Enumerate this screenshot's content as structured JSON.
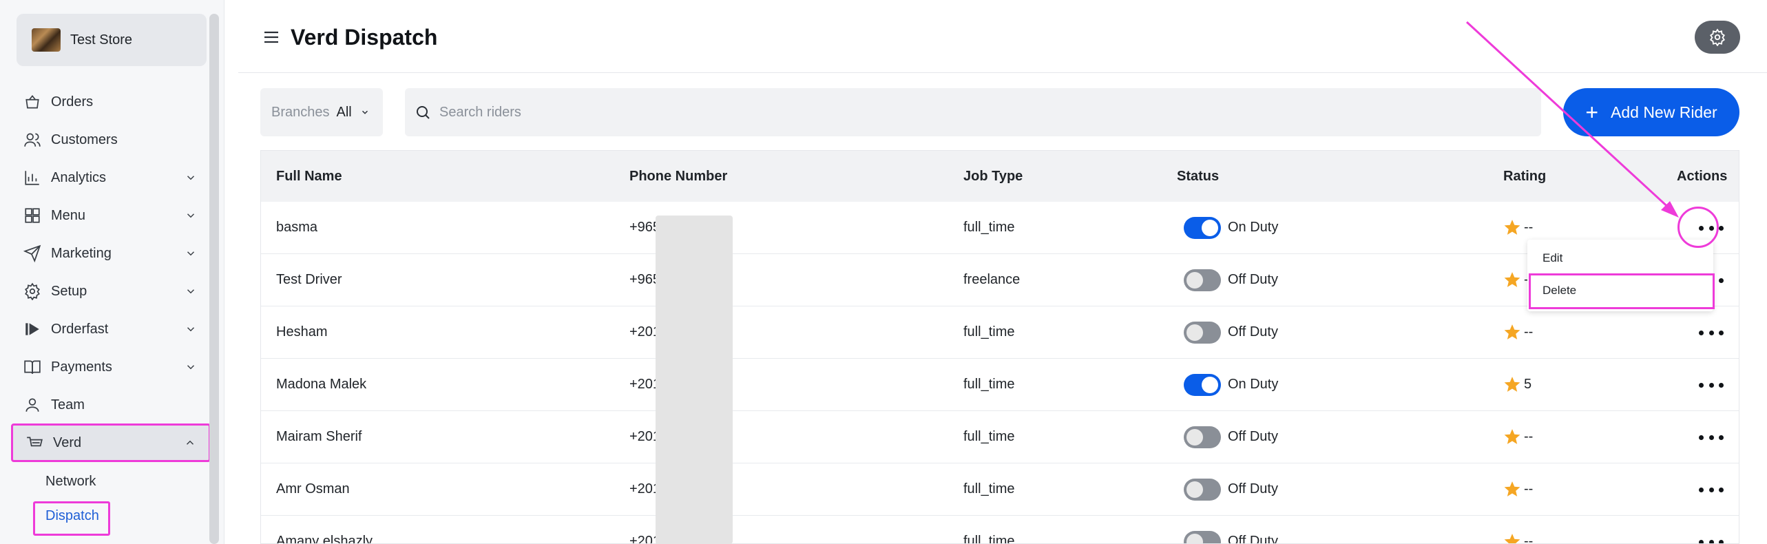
{
  "store": {
    "name": "Test Store"
  },
  "nav": [
    {
      "label": "Orders",
      "icon": "basket-icon"
    },
    {
      "label": "Customers",
      "icon": "users-icon"
    },
    {
      "label": "Analytics",
      "icon": "bar-chart-icon"
    },
    {
      "label": "Menu",
      "icon": "grid-icon"
    },
    {
      "label": "Marketing",
      "icon": "send-icon"
    },
    {
      "label": "Setup",
      "icon": "gear-icon"
    },
    {
      "label": "Orderfast",
      "icon": "play-icon"
    },
    {
      "label": "Payments",
      "icon": "book-icon"
    },
    {
      "label": "Team",
      "icon": "user-icon"
    },
    {
      "label": "Verd",
      "icon": "cart-icon"
    }
  ],
  "subnav": [
    {
      "label": "Network"
    },
    {
      "label": "Dispatch"
    }
  ],
  "header": {
    "title": "Verd Dispatch"
  },
  "filters": {
    "branches_label": "Branches",
    "branches_value": "All"
  },
  "search": {
    "placeholder": "Search riders"
  },
  "add_button": {
    "label": "Add New Rider"
  },
  "table": {
    "columns": [
      "Full Name",
      "Phone Number",
      "Job Type",
      "Status",
      "Rating",
      "Actions"
    ],
    "rows": [
      {
        "name": "basma",
        "phone": "+965",
        "job": "full_time",
        "status": "On Duty",
        "on": true,
        "rating": "--"
      },
      {
        "name": "Test Driver",
        "phone": "+965",
        "job": "freelance",
        "status": "Off Duty",
        "on": false,
        "rating": "--"
      },
      {
        "name": "Hesham",
        "phone": "+201",
        "job": "full_time",
        "status": "Off Duty",
        "on": false,
        "rating": "--"
      },
      {
        "name": "Madona Malek",
        "phone": "+201",
        "job": "full_time",
        "status": "On Duty",
        "on": true,
        "rating": "5"
      },
      {
        "name": "Mairam Sherif",
        "phone": "+201",
        "job": "full_time",
        "status": "Off Duty",
        "on": false,
        "rating": "--"
      },
      {
        "name": "Amr Osman",
        "phone": "+201",
        "job": "full_time",
        "status": "Off Duty",
        "on": false,
        "rating": "--"
      },
      {
        "name": "Amany elshazly",
        "phone": "+201",
        "job": "full_time",
        "status": "Off Duty",
        "on": false,
        "rating": "--"
      }
    ]
  },
  "row_menu": {
    "edit": "Edit",
    "delete": "Delete"
  },
  "colors": {
    "accent": "#0a5de8",
    "highlight": "#ee3bd9",
    "star": "#f5a623"
  }
}
